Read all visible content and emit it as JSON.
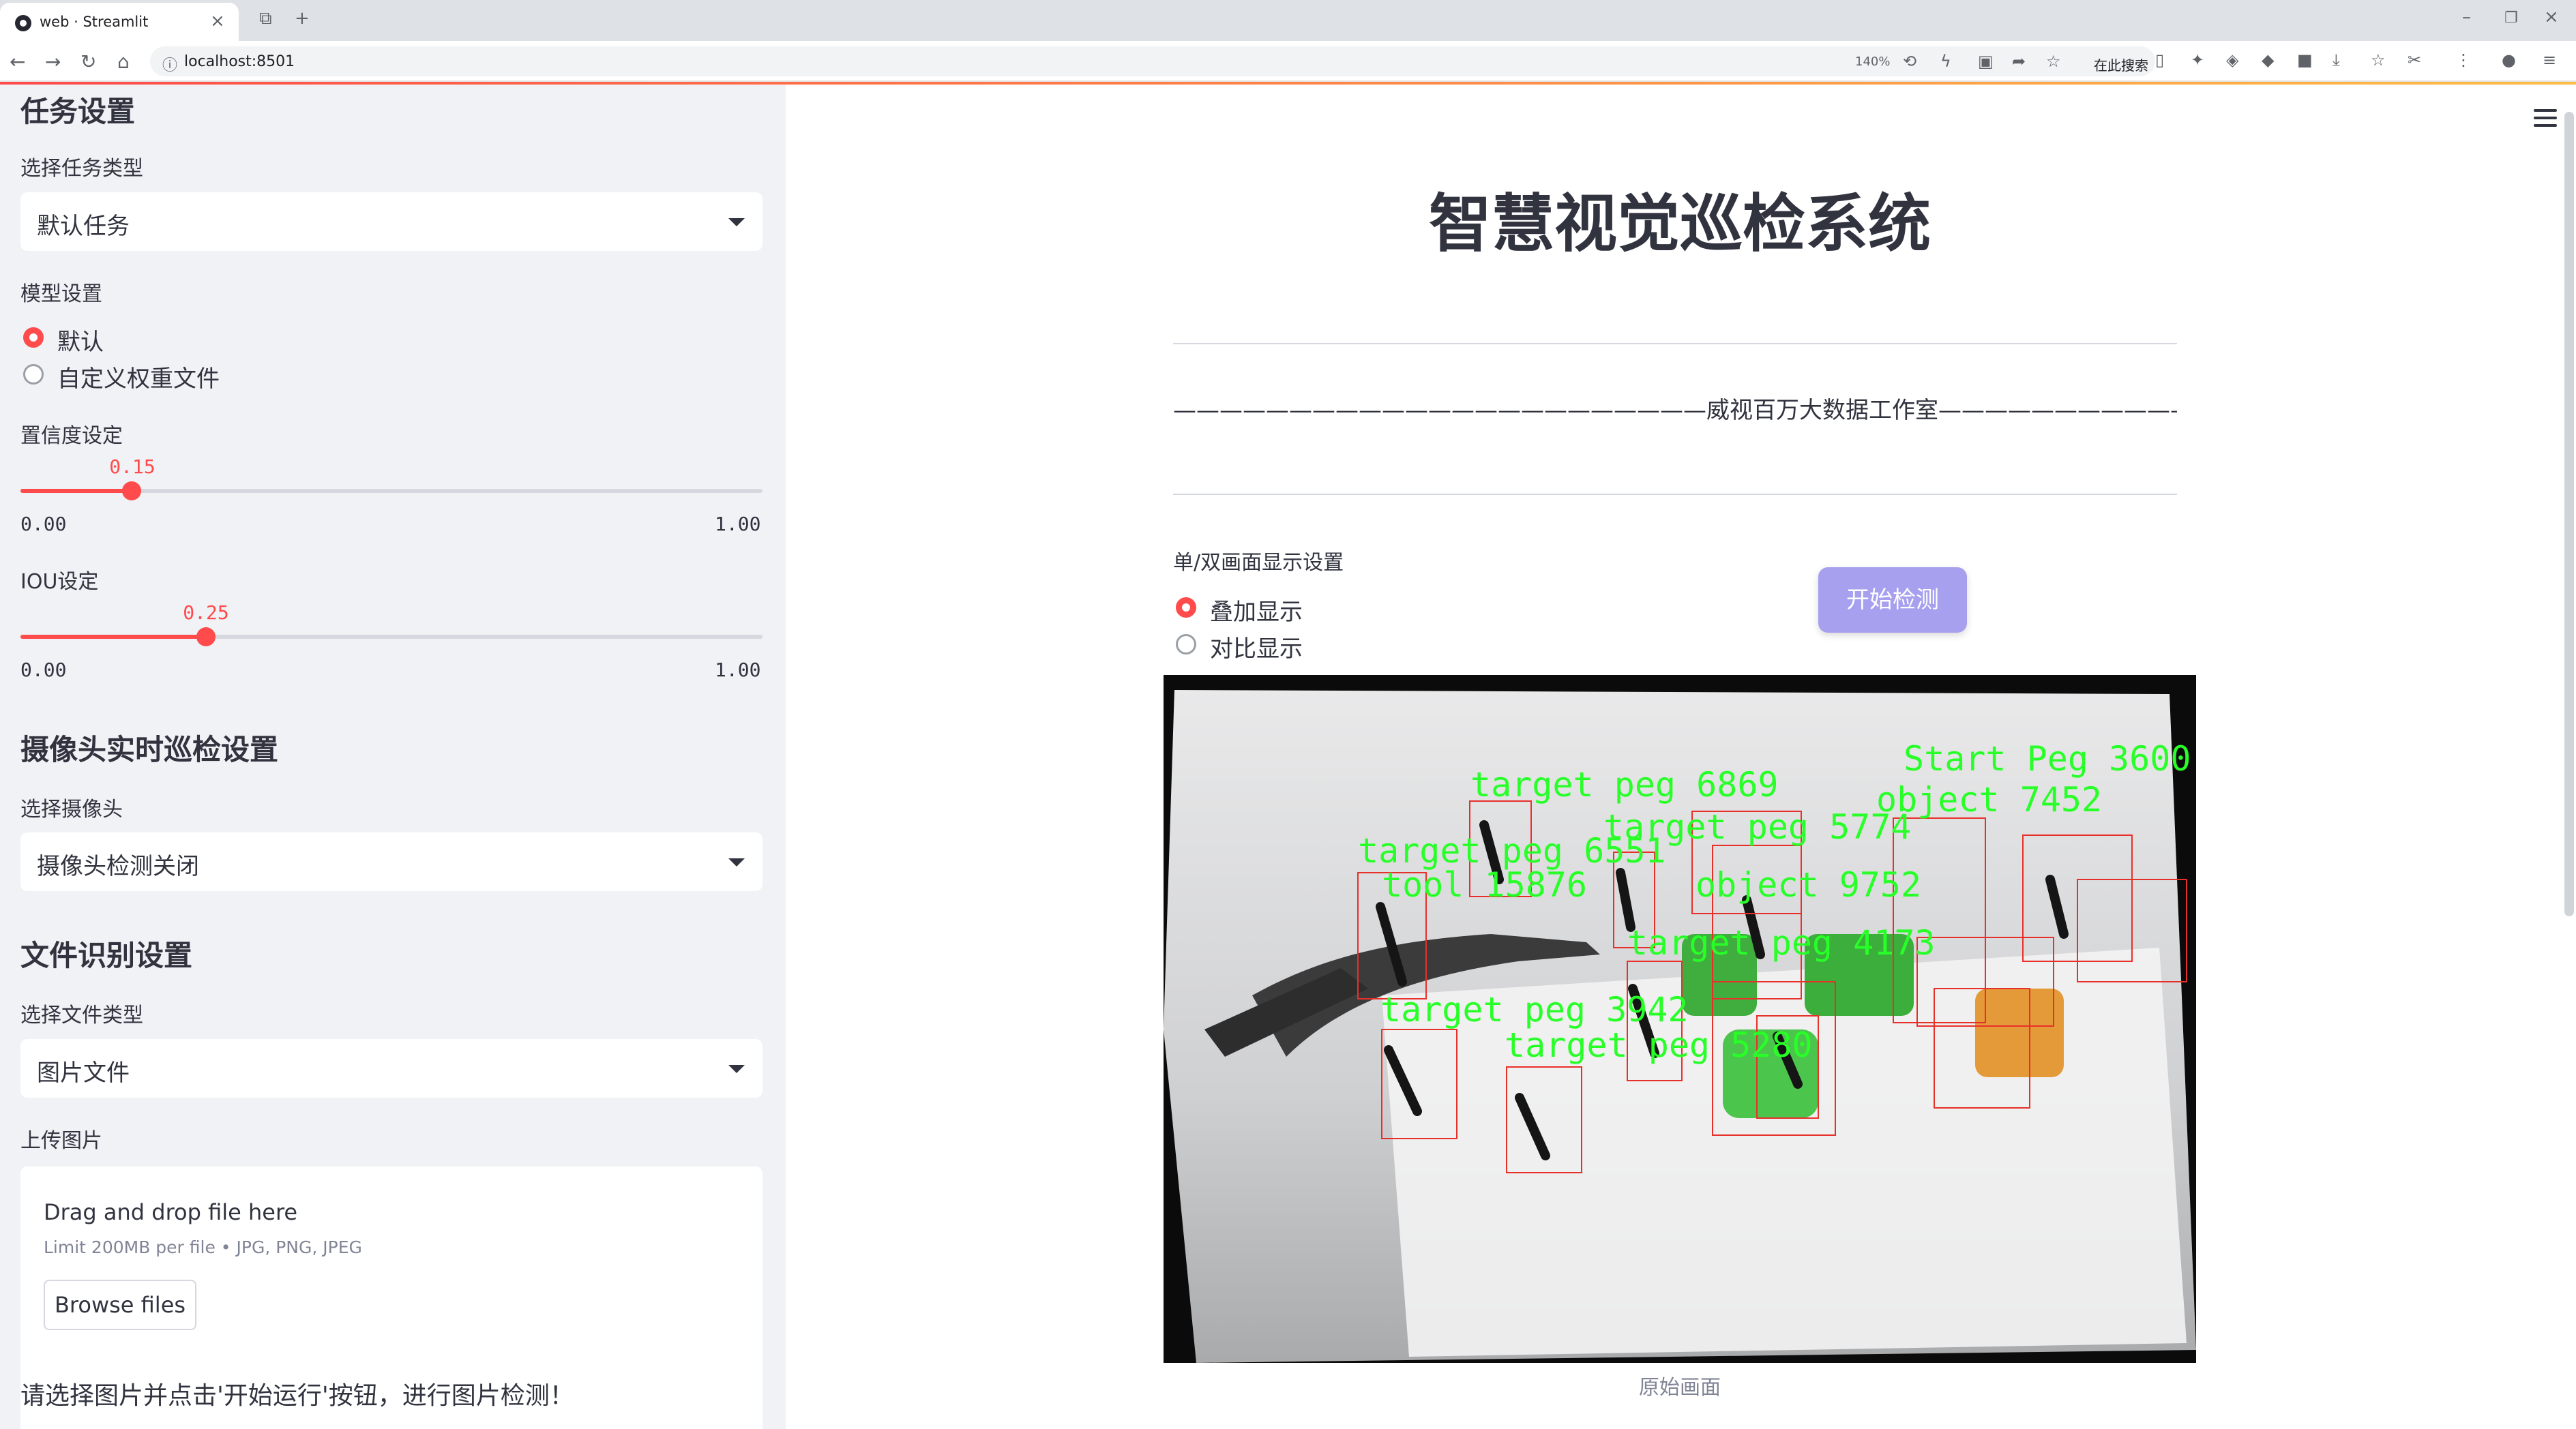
{
  "browser": {
    "tab_title": "web · Streamlit",
    "url": "localhost:8501",
    "zoom": "140%",
    "search_placeholder": "在此搜索"
  },
  "sidebar": {
    "task_section": "任务设置",
    "task_type_label": "选择任务类型",
    "task_type_value": "默认任务",
    "model_label": "模型设置",
    "model_options": [
      "默认",
      "自定义权重文件"
    ],
    "model_selected": "默认",
    "confidence": {
      "label": "置信度设定",
      "value": "0.15",
      "value_num": 0.15,
      "min": "0.00",
      "max": "1.00"
    },
    "iou": {
      "label": "IOU设定",
      "value": "0.25",
      "value_num": 0.25,
      "min": "0.00",
      "max": "1.00"
    },
    "camera_section": "摄像头实时巡检设置",
    "camera_label": "选择摄像头",
    "camera_value": "摄像头检测关闭",
    "file_section": "文件识别设置",
    "file_type_label": "选择文件类型",
    "file_type_value": "图片文件",
    "upload_label": "上传图片",
    "upload": {
      "title": "Drag and drop file here",
      "limit": "Limit 200MB per file • JPG, PNG, JPEG",
      "button": "Browse files"
    },
    "hint": "请选择图片并点击'开始运行'按钮，进行图片检测！"
  },
  "main": {
    "title": "智慧视觉巡检系统",
    "studio_line": "———————————————————————威视百万大数据工作室———————————————————————",
    "display_mode_label": "单/双画面显示设置",
    "display_modes": [
      "叠加显示",
      "对比显示"
    ],
    "display_selected": "叠加显示",
    "start_button": "开始检测",
    "caption": "原始画面"
  },
  "detections": [
    {
      "label": "target peg 6869",
      "color": "#e8302a"
    },
    {
      "label": "object 7452",
      "color": "#e8302a"
    },
    {
      "label": "target peg 5774",
      "color": "#e8302a"
    },
    {
      "label": "target peg 6551",
      "color": "#e8302a"
    },
    {
      "label": "tool 15876",
      "color": "#e8302a"
    },
    {
      "label": "object 9752",
      "color": "#e8302a"
    },
    {
      "label": "Start Peg 3600",
      "color": "#e8302a"
    },
    {
      "label": "target peg 4173",
      "color": "#e8302a"
    },
    {
      "label": "target peg 3942",
      "color": "#e8302a"
    },
    {
      "label": "target peg 5280",
      "color": "#e8302a"
    }
  ],
  "colors": {
    "accent": "#ff4b4b",
    "button": "#a6a0ef",
    "label_text": "#28ff28",
    "box": "#e8302a"
  }
}
